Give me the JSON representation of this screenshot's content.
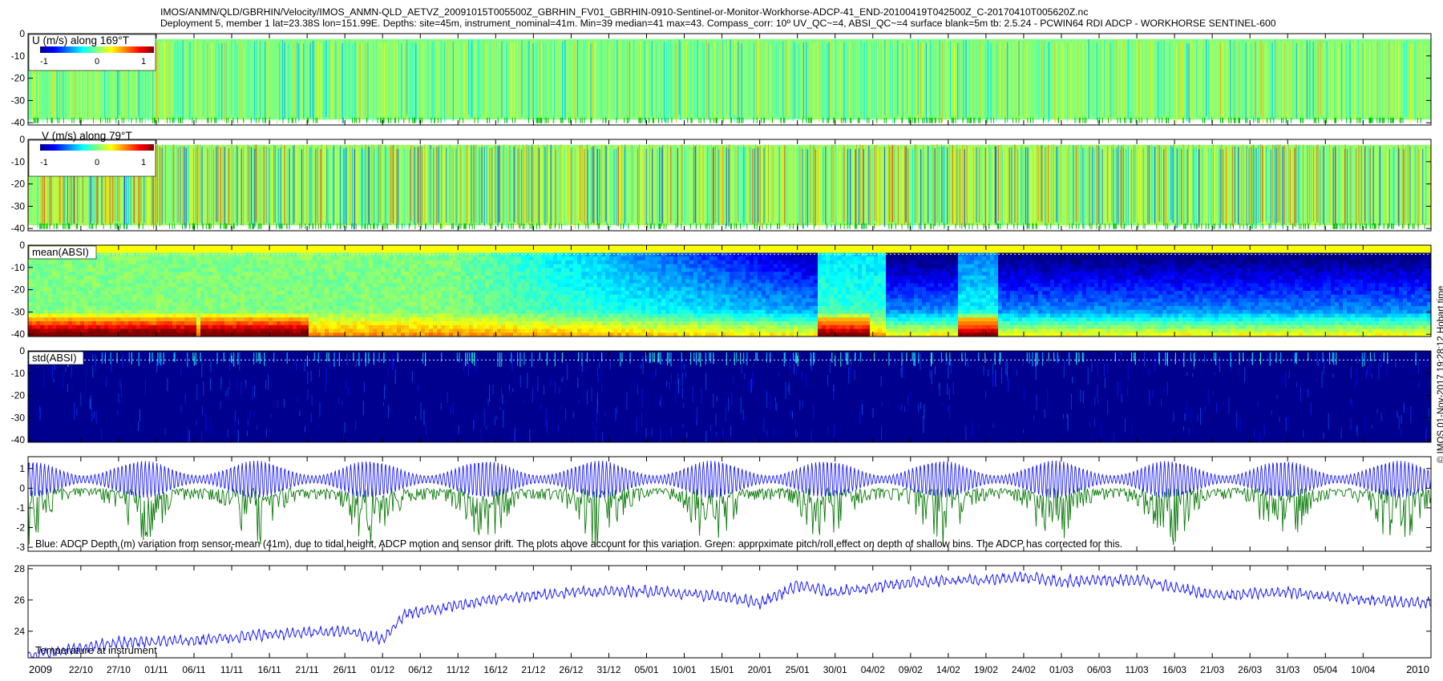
{
  "header": {
    "line1": "IMOS/ANMN/QLD/GBRHIN/Velocity/IMOS_ANMN-QLD_AETVZ_20091015T005500Z_GBRHIN_FV01_GBRHIN-0910-Sentinel-or-Monitor-Workhorse-ADCP-41_END-20100419T042500Z_C-20170410T005620Z.nc",
    "line2": "Deployment 5, member 1 lat=23.38S lon=151.99E. Depths: site=45m, instrument_nominal=41m. Min=39 median=41 max=43. Compass_corr: 10º UV_QC~=4, ABSI_QC~=4 surface blank=5m tb: 2.5.24 - PCWIN64 RDI ADCP - WORKHORSE SENTINEL-600"
  },
  "credit": "© IMOS 01-Nov-2017 19:28:12 Hobart time",
  "colors": {
    "blue_line": "#1a1aff",
    "green_line": "#0a7a0a",
    "axis": "#000000"
  },
  "chart_data": [
    {
      "type": "heatmap",
      "label": "U (m/s) along 169°T",
      "yticks": [
        0,
        -10,
        -20,
        -30,
        -40
      ],
      "ylim": [
        -41,
        0
      ],
      "colorbar": {
        "ticks": [
          "-1",
          "0",
          "1"
        ],
        "range": [
          -1,
          1
        ]
      },
      "dominant_value": 0.0
    },
    {
      "type": "heatmap",
      "label": "V (m/s) along 79°T",
      "yticks": [
        0,
        -10,
        -20,
        -30,
        -40
      ],
      "ylim": [
        -41,
        0
      ],
      "colorbar": {
        "ticks": [
          "-1",
          "0",
          "1"
        ],
        "range": [
          -1,
          1
        ]
      },
      "dominant_value": 0.1
    },
    {
      "type": "heatmap",
      "label": "mean(ABSI)",
      "yticks": [
        0,
        -10,
        -20,
        -30,
        -40
      ],
      "ylim": [
        -41,
        0
      ]
    },
    {
      "type": "heatmap",
      "label": "std(ABSI)",
      "yticks": [
        0,
        -10,
        -20,
        -30,
        -40
      ],
      "ylim": [
        -41,
        0
      ]
    },
    {
      "type": "line",
      "yticks": [
        1,
        0,
        -1,
        -2,
        -3
      ],
      "ylim": [
        -3.2,
        1.6
      ],
      "annotation": "Blue: ADCP Depth (m) variation from sensor-mean (41m), due to tidal height, ADCP motion and sensor drift. The plots above account for this variation. Green: approximate pitch/roll effect on depth of shallow bins. The ADCP has corrected for this.",
      "series": [
        {
          "color": "#1a1aff",
          "amplitude_range": [
            -0.6,
            1.5
          ]
        },
        {
          "color": "#0a7a0a",
          "amplitude_range": [
            -3.0,
            0
          ]
        }
      ]
    },
    {
      "type": "line",
      "label": "Temperature at instrument",
      "yticks": [
        28,
        26,
        24
      ],
      "ylim": [
        22.3,
        28.2
      ],
      "x": [
        "2009-10-15",
        "2009-10-27",
        "2009-11-06",
        "2009-11-16",
        "2009-11-26",
        "2009-12-01",
        "2009-12-04",
        "2009-12-16",
        "2009-12-26",
        "2010-01-05",
        "2010-01-15",
        "2010-01-20",
        "2010-01-25",
        "2010-01-30",
        "2010-02-09",
        "2010-02-19",
        "2010-02-24",
        "2010-03-01",
        "2010-03-11",
        "2010-03-21",
        "2010-03-31",
        "2010-04-10",
        "2010-04-19"
      ],
      "y": [
        22.4,
        23.3,
        23.4,
        23.8,
        24.0,
        23.5,
        25.1,
        26.1,
        26.5,
        26.6,
        26.2,
        25.8,
        26.9,
        26.5,
        27.1,
        27.3,
        27.5,
        27.2,
        27.3,
        26.3,
        26.5,
        26.0,
        25.8
      ]
    }
  ],
  "x_axis": {
    "year_start": "2009",
    "year_end": "2010",
    "tick_labels": [
      "22/10",
      "27/10",
      "01/11",
      "06/11",
      "11/11",
      "16/11",
      "21/11",
      "26/11",
      "01/12",
      "06/12",
      "11/12",
      "16/12",
      "21/12",
      "26/12",
      "31/12",
      "05/01",
      "10/01",
      "15/01",
      "20/01",
      "25/01",
      "30/01",
      "04/02",
      "09/02",
      "14/02",
      "19/02",
      "24/02",
      "01/03",
      "06/03",
      "11/03",
      "16/03",
      "21/03",
      "26/03",
      "31/03",
      "05/04",
      "10/04"
    ]
  }
}
